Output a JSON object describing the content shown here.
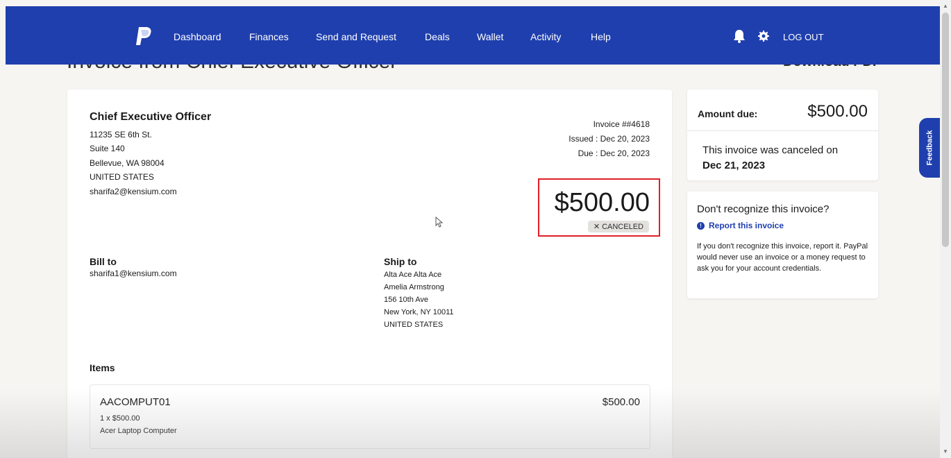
{
  "nav": {
    "items": [
      "Dashboard",
      "Finances",
      "Send and Request",
      "Deals",
      "Wallet",
      "Activity",
      "Help"
    ],
    "logout": "LOG OUT",
    "brand_color": "#1f3fae"
  },
  "page": {
    "title": "Invoice from Chief Executive Officer",
    "download_pdf": "Download PDF"
  },
  "invoice": {
    "from_name": "Chief Executive Officer",
    "from_address": [
      "11235 SE 6th St.",
      "Suite 140",
      "Bellevue, WA 98004",
      "UNITED STATES",
      "sharifa2@kensium.com"
    ],
    "number": "Invoice ##4618",
    "issued": "Issued : Dec 20, 2023",
    "due": "Due : Dec 20, 2023",
    "amount": "$500.00",
    "status": "✕ CANCELED",
    "status_color": "#e01f26",
    "bill_to_label": "Bill to",
    "bill_to_email": "sharifa1@kensium.com",
    "ship_to_label": "Ship to",
    "ship_to_lines": [
      "Alta Ace Alta Ace",
      "Amelia Armstrong",
      "156 10th Ave",
      "New York, NY 10011",
      "UNITED STATES"
    ],
    "items_label": "Items",
    "items": [
      {
        "code": "AACOMPUT01",
        "price": "$500.00",
        "qty": "1 x $500.00",
        "desc": "Acer Laptop Computer"
      }
    ]
  },
  "summary": {
    "amount_due_label": "Amount due:",
    "amount_due": "$500.00",
    "cancel_note": "This invoice was canceled on",
    "cancel_date": "Dec 21, 2023"
  },
  "report": {
    "title": "Don't recognize this invoice?",
    "link": "Report this invoice",
    "body": "If you don't recognize this invoice, report it. PayPal would never use an invoice or a money request to ask you for your account credentials."
  },
  "feedback": "Feedback"
}
